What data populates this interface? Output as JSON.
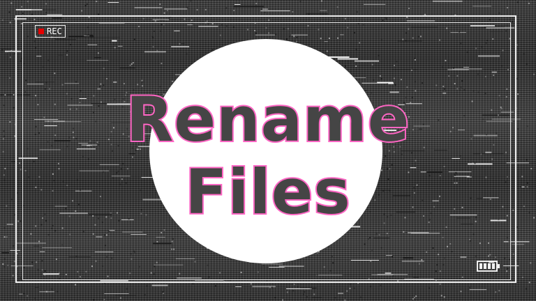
{
  "overlay": {
    "rec_label": "REC",
    "battery_level": 1.0
  },
  "thumbnail": {
    "title_line1": "Rename",
    "title_line2": "Files"
  },
  "colors": {
    "rec_dot": "#e60000",
    "title_fill": "#454545",
    "title_outline": "#ff66c4",
    "circle": "#ffffff",
    "frame": "#f2f2f2"
  },
  "icons": [
    "record-dot-icon",
    "battery-icon"
  ]
}
